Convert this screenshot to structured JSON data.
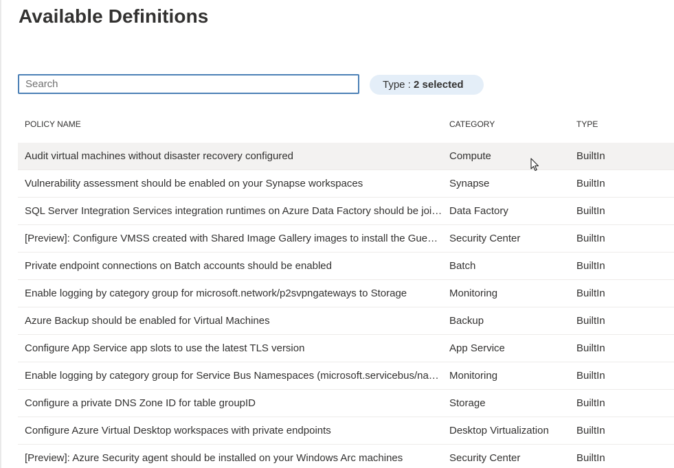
{
  "title": "Available Definitions",
  "search": {
    "placeholder": "Search",
    "value": ""
  },
  "filter": {
    "label": "Type : ",
    "value": "2 selected"
  },
  "columns": {
    "name": "POLICY NAME",
    "category": "CATEGORY",
    "type": "TYPE"
  },
  "rows": [
    {
      "name": "Audit virtual machines without disaster recovery configured",
      "category": "Compute",
      "type": "BuiltIn"
    },
    {
      "name": "Vulnerability assessment should be enabled on your Synapse workspaces",
      "category": "Synapse",
      "type": "BuiltIn"
    },
    {
      "name": "SQL Server Integration Services integration runtimes on Azure Data Factory should be joined to a virtual network",
      "category": "Data Factory",
      "type": "BuiltIn"
    },
    {
      "name": "[Preview]: Configure VMSS created with Shared Image Gallery images to install the Guest Attestation extension",
      "category": "Security Center",
      "type": "BuiltIn"
    },
    {
      "name": "Private endpoint connections on Batch accounts should be enabled",
      "category": "Batch",
      "type": "BuiltIn"
    },
    {
      "name": "Enable logging by category group for microsoft.network/p2svpngateways to Storage",
      "category": "Monitoring",
      "type": "BuiltIn"
    },
    {
      "name": "Azure Backup should be enabled for Virtual Machines",
      "category": "Backup",
      "type": "BuiltIn"
    },
    {
      "name": "Configure App Service app slots to use the latest TLS version",
      "category": "App Service",
      "type": "BuiltIn"
    },
    {
      "name": "Enable logging by category group for Service Bus Namespaces (microsoft.servicebus/namespaces) to Log Analytics",
      "category": "Monitoring",
      "type": "BuiltIn"
    },
    {
      "name": "Configure a private DNS Zone ID for table groupID",
      "category": "Storage",
      "type": "BuiltIn"
    },
    {
      "name": "Configure Azure Virtual Desktop workspaces with private endpoints",
      "category": "Desktop Virtualization",
      "type": "BuiltIn"
    },
    {
      "name": "[Preview]: Azure Security agent should be installed on your Windows Arc machines",
      "category": "Security Center",
      "type": "BuiltIn"
    }
  ],
  "icons": {
    "cursor": "mouse-pointer-icon"
  }
}
